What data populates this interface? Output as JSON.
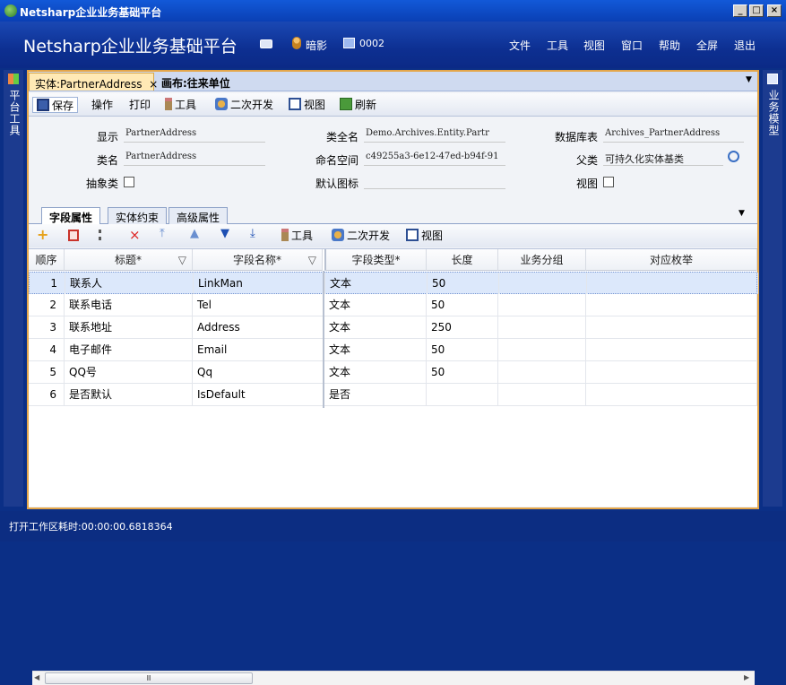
{
  "window": {
    "title": "Netsharp企业业务基础平台",
    "min_label": "_",
    "max_label": "□",
    "close_label": "×"
  },
  "header": {
    "app_title": "Netsharp企业业务基础平台",
    "user": "暗影",
    "org": "0002",
    "menu": [
      "文件",
      "工具",
      "视图",
      "窗口",
      "帮助",
      "全屏",
      "退出"
    ]
  },
  "side_left": {
    "label": "平台工具"
  },
  "side_right": {
    "label": "业务模型"
  },
  "doc_tabs": [
    {
      "label": "实体:PartnerAddress",
      "close": "×"
    },
    {
      "label": "画布:往来单位"
    }
  ],
  "doc_tabs_menu": "▼",
  "toolbar1": {
    "save": "保存",
    "operate": "操作",
    "print": "打印",
    "tools": "工具",
    "devtools": "二次开发",
    "view": "视图",
    "refresh": "刷新"
  },
  "form": {
    "display_label": "显示",
    "display_value": "PartnerAddress",
    "fullname_label": "类全名",
    "fullname_value": "Demo.Archives.Entity.Partr",
    "dbtable_label": "数据库表",
    "dbtable_value": "Archives_PartnerAddress",
    "classname_label": "类名",
    "classname_value": "PartnerAddress",
    "namespace_label": "命名空间",
    "namespace_value": "c49255a3-6e12-47ed-b94f-91",
    "parent_label": "父类",
    "parent_value": "可持久化实体基类",
    "abstract_label": "抽象类",
    "icon_label": "默认图标",
    "view_label": "视图"
  },
  "sub_tabs": [
    "字段属性",
    "实体约束",
    "高级属性"
  ],
  "sub_tabs_menu": "▼",
  "toolbar2": {
    "tools": "工具",
    "devtools": "二次开发",
    "view": "视图"
  },
  "grid": {
    "columns": [
      "顺序",
      "标题*",
      "字段名称*",
      "字段类型*",
      "长度",
      "业务分组",
      "对应枚举"
    ],
    "rows": [
      {
        "order": "1",
        "title": "联系人",
        "name": "LinkMan",
        "type": "文本",
        "length": "50"
      },
      {
        "order": "2",
        "title": "联系电话",
        "name": "Tel",
        "type": "文本",
        "length": "50"
      },
      {
        "order": "3",
        "title": "联系地址",
        "name": "Address",
        "type": "文本",
        "length": "250"
      },
      {
        "order": "4",
        "title": "电子邮件",
        "name": "Email",
        "type": "文本",
        "length": "50"
      },
      {
        "order": "5",
        "title": "QQ号",
        "name": "Qq",
        "type": "文本",
        "length": "50"
      },
      {
        "order": "6",
        "title": "是否默认",
        "name": "IsDefault",
        "type": "是否",
        "length": ""
      }
    ],
    "scroll_grip": "Ⅲ"
  },
  "status": {
    "text": "打开工作区耗时:00:00:00.6818364"
  },
  "colors": {
    "accent": "#0b2f86",
    "highlight": "#dce8fb",
    "tab_border": "#e4a64a"
  }
}
